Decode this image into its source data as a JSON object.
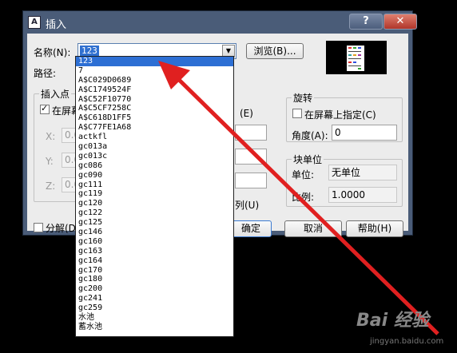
{
  "dialog": {
    "title": "插入",
    "help_glyph": "?",
    "close_glyph": "✕",
    "name_label": "名称(N):",
    "name_value": "123",
    "browse_button": "浏览(B)...",
    "path_label": "路径:",
    "insertion_group": "插入点",
    "insertion_onscreen": "在屏幕",
    "x_label": "X:",
    "y_label": "Y:",
    "z_label": "Z:",
    "coord_value": "0.0",
    "scale_onscreen_fragment": "(E)",
    "uniform_fragment": "列(U)",
    "rotation_group": "旋转",
    "rotation_onscreen": "在屏幕上指定(C)",
    "angle_label": "角度(A):",
    "angle_value": "0",
    "block_unit_group": "块单位",
    "unit_label": "单位:",
    "unit_value": "无单位",
    "ratio_label": "比例:",
    "ratio_value": "1.0000",
    "explode_label": "分解(D)",
    "ok_fragment": "确定",
    "cancel_button": "取消",
    "help_button": "帮助(H)"
  },
  "dropdown": {
    "selected_index": 0,
    "items": [
      "123",
      "7",
      "A$C029D0689",
      "A$C1749524F",
      "A$C52F10770",
      "A$C5CF7258C",
      "A$C618D1FF5",
      "A$C77FE1A68",
      "actkfl",
      "gc013a",
      "gc013c",
      "gc086",
      "gc090",
      "gc111",
      "gc119",
      "gc120",
      "gc122",
      "gc125",
      "gc146",
      "gc160",
      "gc163",
      "gc164",
      "gc170",
      "gc180",
      "gc200",
      "gc241",
      "gc259",
      "水池",
      "蓄水池"
    ]
  },
  "watermark": {
    "brand": "Bai 经验",
    "url": "jingyan.baidu.com"
  },
  "colors": {
    "arrow": "#e02020",
    "selection": "#2d6fd4",
    "window_frame": "#4a5c78"
  }
}
